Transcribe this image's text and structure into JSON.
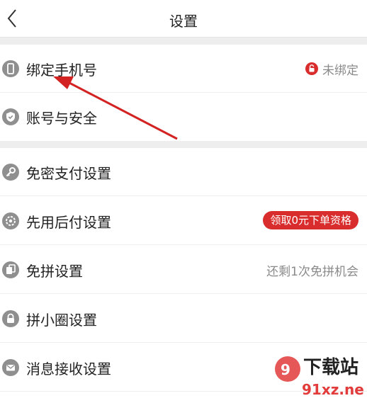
{
  "header": {
    "title": "设置"
  },
  "rows": [
    {
      "label": "绑定手机号",
      "value": "未绑定"
    },
    {
      "label": "账号与安全"
    },
    {
      "label": "免密支付设置"
    },
    {
      "label": "先用后付设置",
      "badge": "领取0元下单资格"
    },
    {
      "label": "免拼设置",
      "value": "还剩1次免拼机会"
    },
    {
      "label": "拼小圈设置"
    },
    {
      "label": "消息接收设置"
    }
  ],
  "watermark": {
    "brand": "下载站",
    "site": "91xz.net"
  },
  "colors": {
    "accent": "#d92c2c",
    "icon": "#8f8f8f",
    "gap": "#eeeeee"
  }
}
